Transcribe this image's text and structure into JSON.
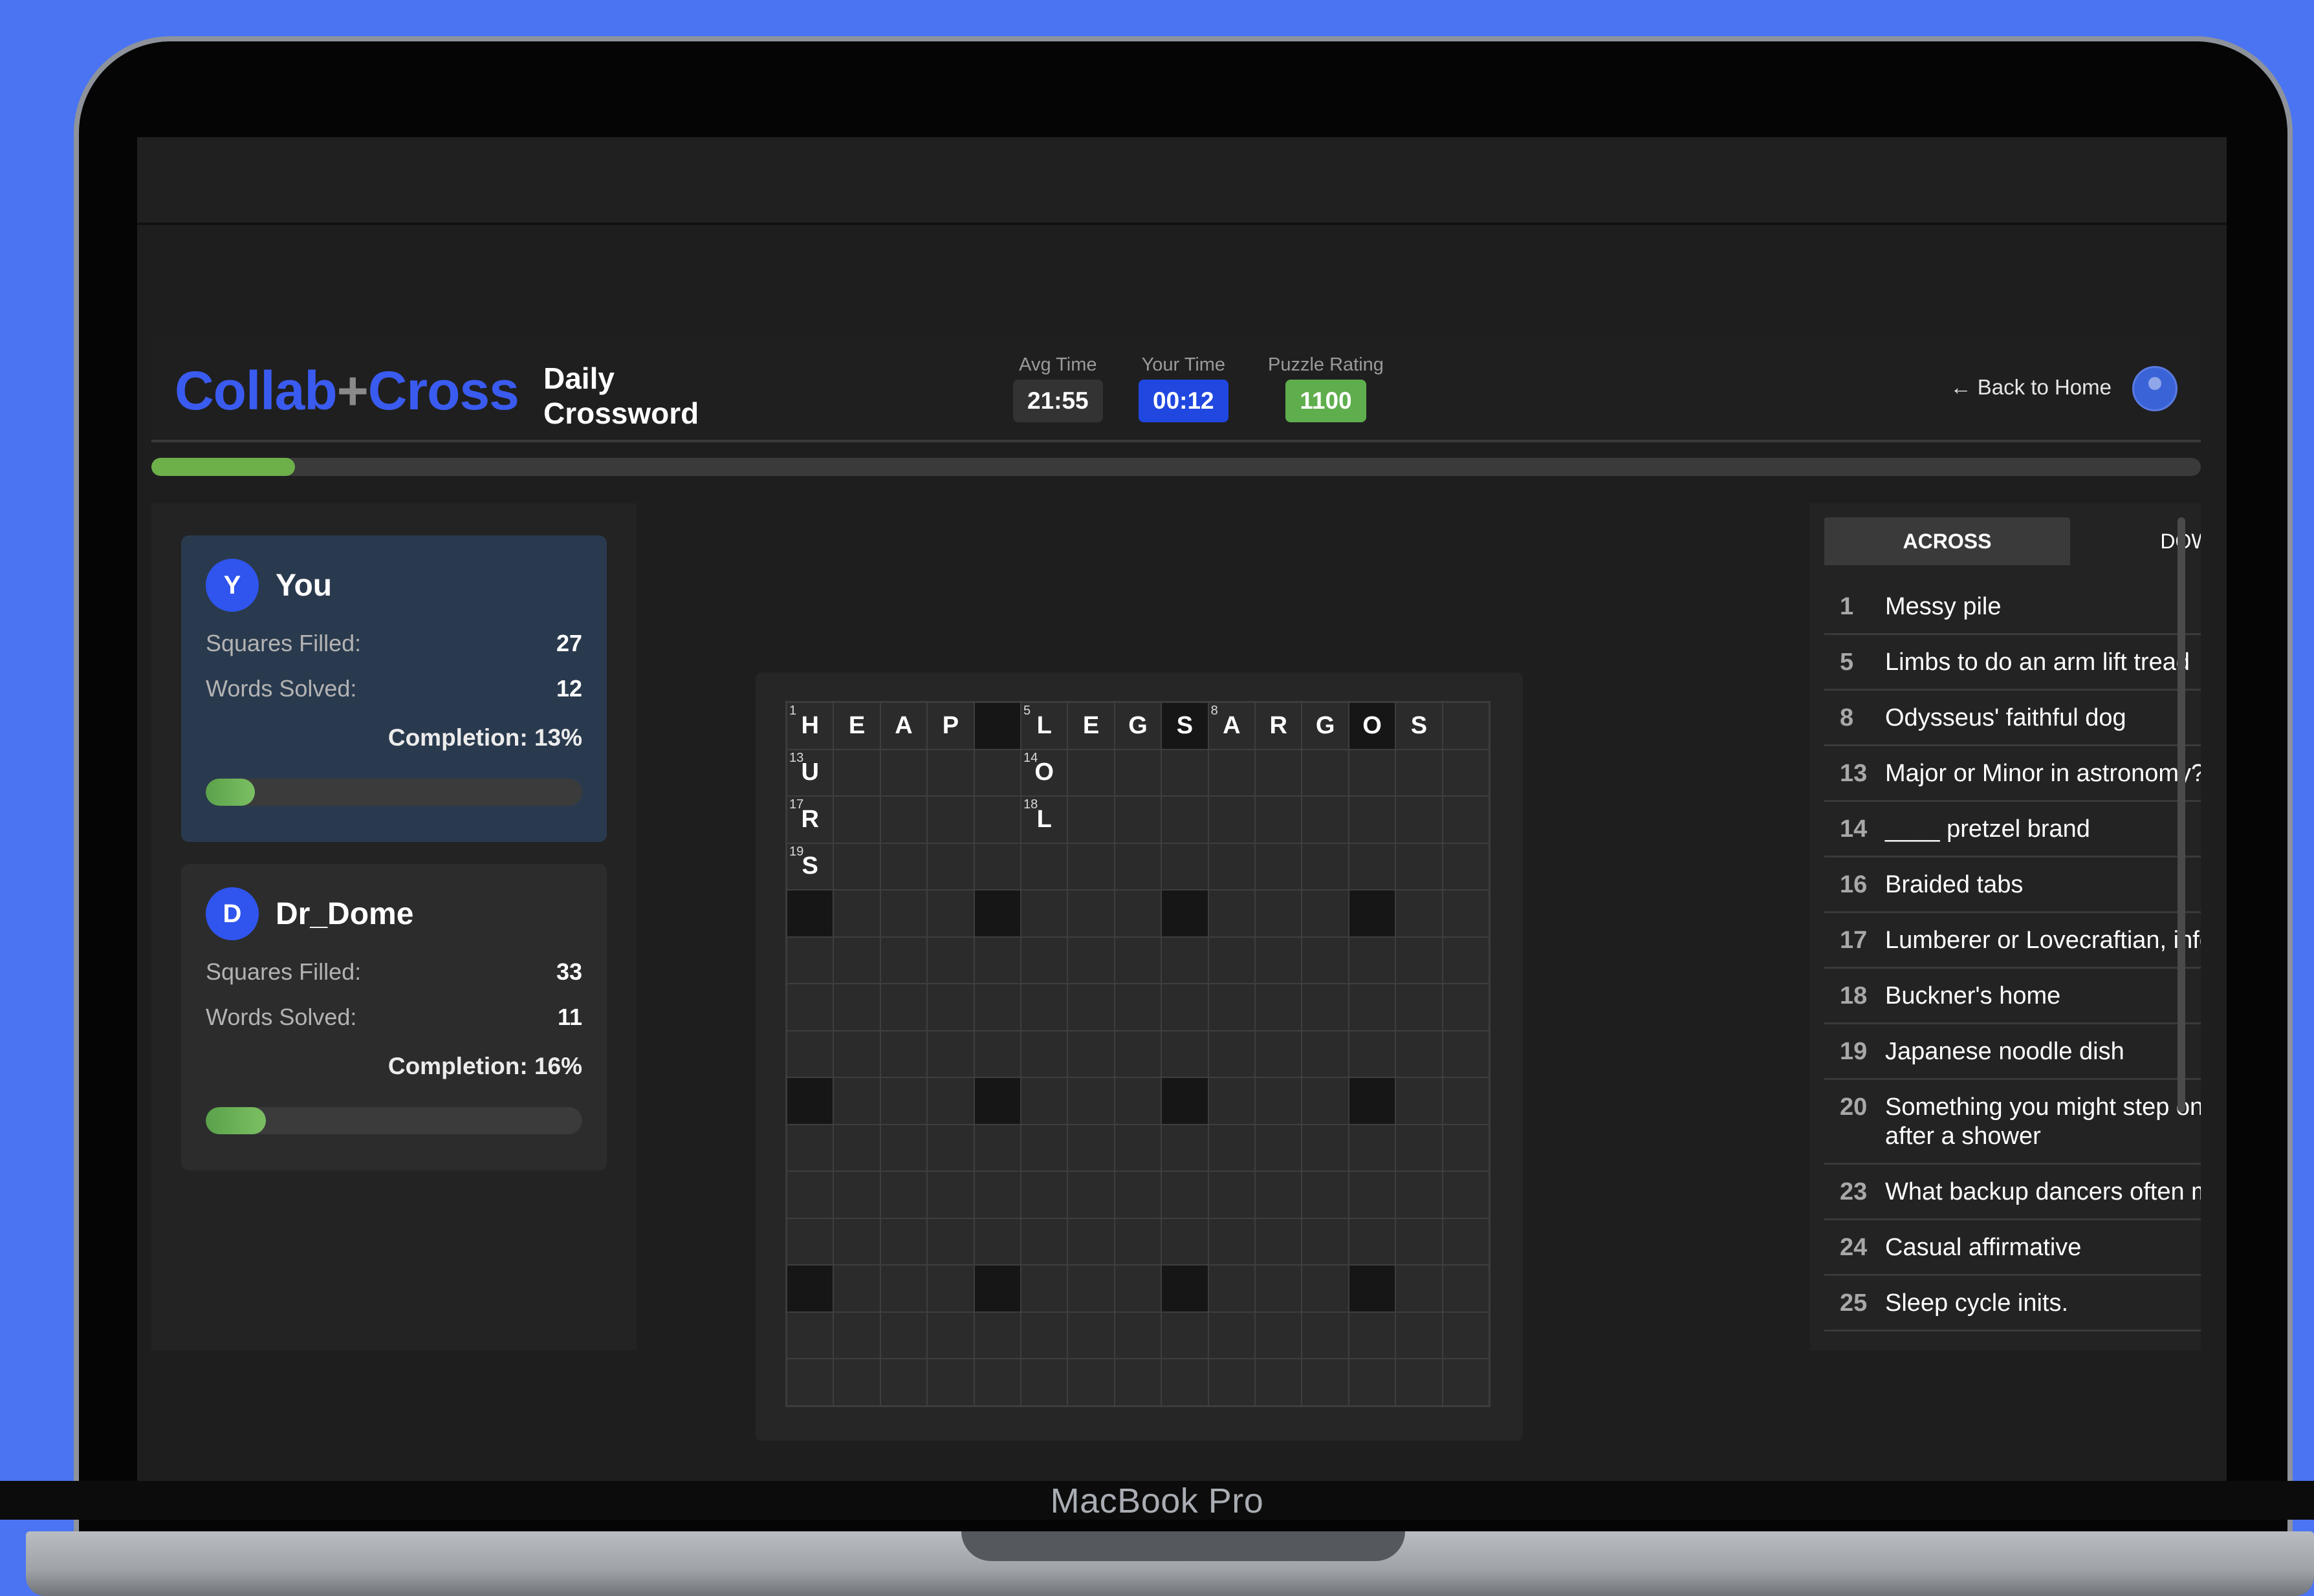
{
  "device": {
    "brand": "MacBook Pro"
  },
  "header": {
    "logo_left": "Collab",
    "logo_plus": "+",
    "logo_right": "Cross",
    "subtitle": "Daily Crossword",
    "avg_time_label": "Avg Time",
    "avg_time": "21:55",
    "your_time_label": "Your Time",
    "your_time": "00:12",
    "rating_label": "Puzzle Rating",
    "rating": "1100",
    "back_label": "← Back to Home"
  },
  "colors": {
    "accent": "#2f55ee",
    "your_time_bg": "#2047e0",
    "rating_bg": "#5fae4d",
    "avg_time_bg": "#333334",
    "progress": "#6db04a"
  },
  "overall_progress": 0.07,
  "players": [
    {
      "initial": "Y",
      "name": "You",
      "squares_label": "Squares Filled:",
      "squares": "27",
      "words_label": "Words Solved:",
      "words": "12",
      "completion_label": "Completion: 13%",
      "completion": 0.13
    },
    {
      "initial": "D",
      "name": "Dr_Dome",
      "squares_label": "Squares Filled:",
      "squares": "33",
      "words_label": "Words Solved:",
      "words": "11",
      "completion_label": "Completion: 16%",
      "completion": 0.16
    }
  ],
  "grid": {
    "size": 15,
    "black_cells": [
      [
        0,
        4
      ],
      [
        0,
        8
      ],
      [
        0,
        12
      ],
      [
        4,
        0
      ],
      [
        4,
        4
      ],
      [
        4,
        8
      ],
      [
        4,
        12
      ],
      [
        8,
        0
      ],
      [
        8,
        4
      ],
      [
        8,
        8
      ],
      [
        8,
        12
      ],
      [
        12,
        0
      ],
      [
        12,
        4
      ],
      [
        12,
        8
      ],
      [
        12,
        12
      ]
    ],
    "letters": [
      [
        0,
        0,
        "H"
      ],
      [
        0,
        1,
        "E"
      ],
      [
        0,
        2,
        "A"
      ],
      [
        0,
        3,
        "P"
      ],
      [
        0,
        5,
        "L"
      ],
      [
        0,
        6,
        "E"
      ],
      [
        0,
        7,
        "G"
      ],
      [
        0,
        8,
        "S"
      ],
      [
        0,
        9,
        "A"
      ],
      [
        0,
        10,
        "R"
      ],
      [
        0,
        11,
        "G"
      ],
      [
        0,
        12,
        "O"
      ],
      [
        0,
        13,
        "S"
      ],
      [
        1,
        0,
        "U"
      ],
      [
        1,
        5,
        "O"
      ],
      [
        2,
        0,
        "R"
      ],
      [
        2,
        5,
        "L"
      ],
      [
        3,
        0,
        "S"
      ]
    ],
    "numbers": [
      [
        0,
        0,
        "1"
      ],
      [
        0,
        5,
        "5"
      ],
      [
        0,
        9,
        "8"
      ],
      [
        1,
        0,
        "13"
      ],
      [
        1,
        5,
        "14"
      ],
      [
        2,
        0,
        "17"
      ],
      [
        2,
        5,
        "18"
      ],
      [
        3,
        0,
        "19"
      ]
    ]
  },
  "clues": {
    "tab_across": "ACROSS",
    "tab_down": "DOWN",
    "across": [
      {
        "num": "1",
        "text": "Messy pile"
      },
      {
        "num": "5",
        "text": "Limbs to do an arm lift tread"
      },
      {
        "num": "8",
        "text": "Odysseus' faithful dog"
      },
      {
        "num": "13",
        "text": "Major or Minor in astronomy?"
      },
      {
        "num": "14",
        "text": "____ pretzel brand"
      },
      {
        "num": "16",
        "text": "Braided tabs"
      },
      {
        "num": "17",
        "text": "Lumberer or Lovecraftian, informally"
      },
      {
        "num": "18",
        "text": "Buckner's home"
      },
      {
        "num": "19",
        "text": "Japanese noodle dish"
      },
      {
        "num": "20",
        "text": "Something you might step on before or after a shower"
      },
      {
        "num": "23",
        "text": "What backup dancers often move in"
      },
      {
        "num": "24",
        "text": "Casual affirmative"
      },
      {
        "num": "25",
        "text": "Sleep cycle inits."
      }
    ]
  }
}
